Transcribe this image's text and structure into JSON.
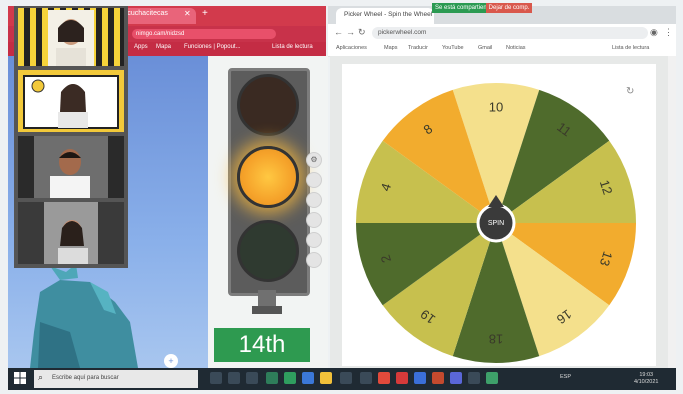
{
  "left_browser": {
    "tab_title": "ascuchacitecas",
    "url": "nimgo.cam/nidzsd",
    "bookmarks": [
      "Apps",
      "Mapa",
      "Funciones | Popout...",
      "Lista de lectura"
    ]
  },
  "traffic_light": {
    "active_lamp": "amber",
    "badge": "14th"
  },
  "right_browser": {
    "tab_title": "Picker Wheel - Spin the Wheel",
    "share_text": "Se está compartiendo",
    "stop_share": "Dejar de comp.",
    "url": "pickerwheel.com",
    "bookmarks": [
      "Aplicaciones",
      "Maps",
      "Traducir",
      "YouTube",
      "Gmail",
      "Noticias",
      "Lista de lectura"
    ]
  },
  "wheel": {
    "center_label": "SPIN",
    "slices": [
      {
        "label": "10",
        "color": "#f4e08c"
      },
      {
        "label": "11",
        "color": "#4f6b2c"
      },
      {
        "label": "12",
        "color": "#c7c04e"
      },
      {
        "label": "13",
        "color": "#f2ac2e"
      },
      {
        "label": "16",
        "color": "#f4e08c"
      },
      {
        "label": "18",
        "color": "#4f6b2c"
      },
      {
        "label": "19",
        "color": "#c7c04e"
      },
      {
        "label": "2",
        "color": "#4f6b2c"
      },
      {
        "label": "4",
        "color": "#c7c04e"
      },
      {
        "label": "8",
        "color": "#f2ac2e"
      }
    ]
  },
  "taskbar": {
    "search_placeholder": "Escribe aquí para buscar",
    "tray_text": "ESP",
    "clock_time": "19:03",
    "clock_date": "4/10/2021"
  },
  "colors": {
    "chrome_red": "#d23a4c",
    "badge_green": "#2e9a50",
    "taskbar": "#1f2a33"
  }
}
